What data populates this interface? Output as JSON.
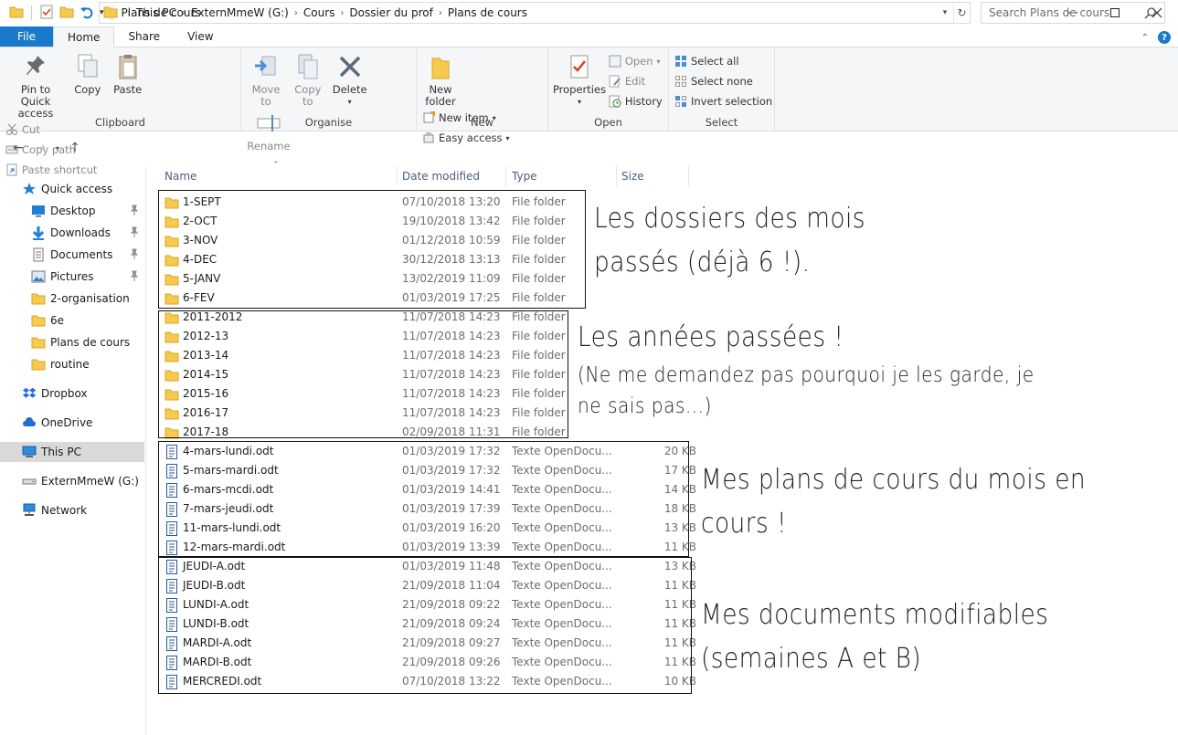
{
  "window": {
    "title": "Plans de cours"
  },
  "ribbon_tabs": [
    {
      "label": "File"
    },
    {
      "label": "Home"
    },
    {
      "label": "Share"
    },
    {
      "label": "View"
    }
  ],
  "ribbon": {
    "clipboard": {
      "label": "Clipboard",
      "pin_label": "Pin to Quick\naccess",
      "copy_label": "Copy",
      "paste_label": "Paste",
      "cut_label": "Cut",
      "copy_path_label": "Copy path",
      "paste_shortcut_label": "Paste shortcut"
    },
    "organise": {
      "label": "Organise",
      "move_to_label": "Move\nto",
      "copy_to_label": "Copy\nto",
      "delete_label": "Delete",
      "rename_label": "Rename"
    },
    "new": {
      "label": "New",
      "new_folder_label": "New\nfolder",
      "new_item_label": "New item",
      "easy_access_label": "Easy access"
    },
    "open": {
      "label": "Open",
      "properties_label": "Properties",
      "open_label": "Open",
      "edit_label": "Edit",
      "history_label": "History"
    },
    "select": {
      "label": "Select",
      "select_all_label": "Select all",
      "select_none_label": "Select none",
      "invert_label": "Invert selection"
    }
  },
  "address": {
    "breadcrumbs": [
      "This PC",
      "ExternMmeW (G:)",
      "Cours",
      "Dossier du prof",
      "Plans de cours"
    ],
    "search_placeholder": "Search Plans de cours"
  },
  "nav": {
    "quick_access": "Quick access",
    "items": [
      "Desktop",
      "Downloads",
      "Documents",
      "Pictures",
      "2-organisation",
      "6e",
      "Plans de cours",
      "routine"
    ],
    "dropbox": "Dropbox",
    "onedrive": "OneDrive",
    "this_pc": "This PC",
    "drive": "ExternMmeW (G:)",
    "network": "Network"
  },
  "columns": {
    "name": "Name",
    "date": "Date modified",
    "type": "Type",
    "size": "Size"
  },
  "files": [
    {
      "name": "1-SEPT",
      "date": "07/10/2018 13:20",
      "type": "File folder",
      "size": "",
      "kind": "folder"
    },
    {
      "name": "2-OCT",
      "date": "19/10/2018 13:42",
      "type": "File folder",
      "size": "",
      "kind": "folder"
    },
    {
      "name": "3-NOV",
      "date": "01/12/2018 10:59",
      "type": "File folder",
      "size": "",
      "kind": "folder"
    },
    {
      "name": "4-DEC",
      "date": "30/12/2018 13:13",
      "type": "File folder",
      "size": "",
      "kind": "folder"
    },
    {
      "name": "5-JANV",
      "date": "13/02/2019 11:09",
      "type": "File folder",
      "size": "",
      "kind": "folder"
    },
    {
      "name": "6-FEV",
      "date": "01/03/2019 17:25",
      "type": "File folder",
      "size": "",
      "kind": "folder"
    },
    {
      "name": "2011-2012",
      "date": "11/07/2018 14:23",
      "type": "File folder",
      "size": "",
      "kind": "folder"
    },
    {
      "name": "2012-13",
      "date": "11/07/2018 14:23",
      "type": "File folder",
      "size": "",
      "kind": "folder"
    },
    {
      "name": "2013-14",
      "date": "11/07/2018 14:23",
      "type": "File folder",
      "size": "",
      "kind": "folder"
    },
    {
      "name": "2014-15",
      "date": "11/07/2018 14:23",
      "type": "File folder",
      "size": "",
      "kind": "folder"
    },
    {
      "name": "2015-16",
      "date": "11/07/2018 14:23",
      "type": "File folder",
      "size": "",
      "kind": "folder"
    },
    {
      "name": "2016-17",
      "date": "11/07/2018 14:23",
      "type": "File folder",
      "size": "",
      "kind": "folder"
    },
    {
      "name": "2017-18",
      "date": "02/09/2018 11:31",
      "type": "File folder",
      "size": "",
      "kind": "folder"
    },
    {
      "name": "4-mars-lundi.odt",
      "date": "01/03/2019 17:32",
      "type": "Texte OpenDocu...",
      "size": "20 KB",
      "kind": "doc"
    },
    {
      "name": "5-mars-mardi.odt",
      "date": "01/03/2019 17:32",
      "type": "Texte OpenDocu...",
      "size": "17 KB",
      "kind": "doc"
    },
    {
      "name": "6-mars-mcdi.odt",
      "date": "01/03/2019 14:41",
      "type": "Texte OpenDocu...",
      "size": "14 KB",
      "kind": "doc"
    },
    {
      "name": "7-mars-jeudi.odt",
      "date": "01/03/2019 17:39",
      "type": "Texte OpenDocu...",
      "size": "18 KB",
      "kind": "doc"
    },
    {
      "name": "11-mars-lundi.odt",
      "date": "01/03/2019 16:20",
      "type": "Texte OpenDocu...",
      "size": "13 KB",
      "kind": "doc"
    },
    {
      "name": "12-mars-mardi.odt",
      "date": "01/03/2019 13:39",
      "type": "Texte OpenDocu...",
      "size": "11 KB",
      "kind": "doc"
    },
    {
      "name": "JEUDI-A.odt",
      "date": "01/03/2019 11:48",
      "type": "Texte OpenDocu...",
      "size": "13 KB",
      "kind": "doc"
    },
    {
      "name": "JEUDI-B.odt",
      "date": "21/09/2018 11:04",
      "type": "Texte OpenDocu...",
      "size": "11 KB",
      "kind": "doc"
    },
    {
      "name": "LUNDI-A.odt",
      "date": "21/09/2018 09:22",
      "type": "Texte OpenDocu...",
      "size": "11 KB",
      "kind": "doc"
    },
    {
      "name": "LUNDI-B.odt",
      "date": "21/09/2018 09:24",
      "type": "Texte OpenDocu...",
      "size": "11 KB",
      "kind": "doc"
    },
    {
      "name": "MARDI-A.odt",
      "date": "21/09/2018 09:27",
      "type": "Texte OpenDocu...",
      "size": "11 KB",
      "kind": "doc"
    },
    {
      "name": "MARDI-B.odt",
      "date": "21/09/2018 09:26",
      "type": "Texte OpenDocu...",
      "size": "11 KB",
      "kind": "doc"
    },
    {
      "name": "MERCREDI.odt",
      "date": "07/10/2018 13:22",
      "type": "Texte OpenDocu...",
      "size": "10 KB",
      "kind": "doc"
    }
  ],
  "annotations": {
    "months_line1": "Les dossiers des mois",
    "months_line2": "passés (déjà 6 !).",
    "years_line1": "Les années passées !",
    "years_line2": "(Ne me demandez pas pourquoi je les garde, je",
    "years_line3": "ne sais pas...)",
    "plans_line1": "Mes plans de cours du mois en",
    "plans_line2": "cours !",
    "docs_line1": "Mes documents modifiables",
    "docs_line2": "(semaines A et B)"
  },
  "colors": {
    "accent": "#1979ca",
    "folder": "#f6c94f",
    "selected_nav": "#d9d9d9"
  }
}
